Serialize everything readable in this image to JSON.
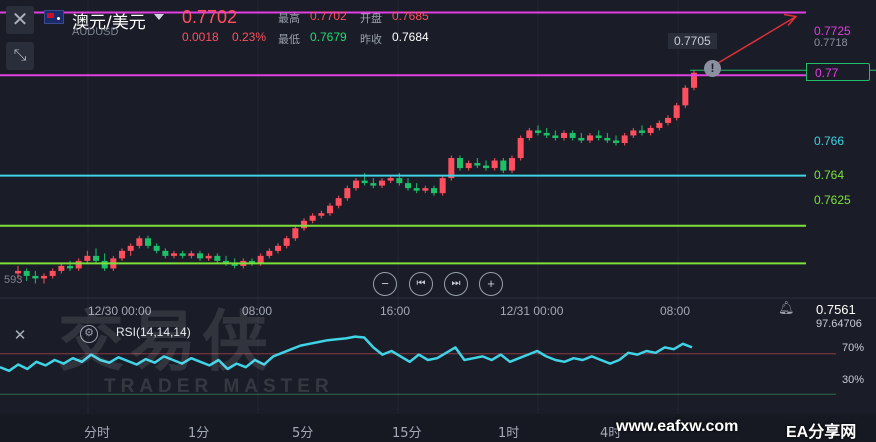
{
  "header": {
    "symbol_name": "澳元/美元",
    "symbol_code": "AUDUSD",
    "last_price": "0.7702",
    "change": "0.0018",
    "change_pct": "0.23%",
    "stats": {
      "high_label": "最高",
      "high_value": "0.7702",
      "open_label": "开盘",
      "open_value": "0.7685",
      "low_label": "最低",
      "low_value": "0.7679",
      "prev_close_label": "昨收",
      "prev_close_value": "0.7684"
    }
  },
  "price_axis": {
    "levels": [
      {
        "value": "0.7725",
        "color": "#e040e0"
      },
      {
        "value": "0.7718",
        "color": "#8a90a0"
      },
      {
        "value": "0.77",
        "color": "#e040e0"
      },
      {
        "value": "0.766",
        "color": "#3fd3e6"
      },
      {
        "value": "0.764",
        "color": "#7ee03a"
      },
      {
        "value": "0.7625",
        "color": "#7ee03a"
      }
    ],
    "crosshair_value": "0.7705",
    "left_value": "593"
  },
  "time_axis": [
    "12/30 00:00",
    "08:00",
    "16:00",
    "12/31 00:00",
    "08:00"
  ],
  "nav_controls": {
    "zoom_out": "−",
    "prev": "⏮",
    "next": "⏭",
    "zoom_in": "+"
  },
  "rsi": {
    "label": "RSI(14,14,14)",
    "current_value": "0.7561",
    "top_value": "97.64706",
    "level_70": "70%",
    "level_30": "30%"
  },
  "timeframes": [
    "分时",
    "1分",
    "5分",
    "15分",
    "1时",
    "4时"
  ],
  "watermark": {
    "brand": "交易侠",
    "brand_en": "TRADER MASTER",
    "site_url": "www.eafxw.com",
    "site_name": "EA分享网"
  },
  "colors": {
    "up": "#ff4f5e",
    "down": "#1fbf6a",
    "magenta_line": "#e040e0",
    "cyan_line": "#3fd3e6",
    "green_line": "#7ee03a",
    "rsi_line": "#3fd3e6"
  },
  "chart_data": {
    "type": "candlestick",
    "ohlc": [
      [
        0.7621,
        0.7624,
        0.7619,
        0.7622
      ],
      [
        0.7622,
        0.7623,
        0.7618,
        0.762
      ],
      [
        0.762,
        0.7622,
        0.7617,
        0.7619
      ],
      [
        0.7619,
        0.7621,
        0.7617,
        0.762
      ],
      [
        0.762,
        0.7623,
        0.7619,
        0.7622
      ],
      [
        0.7622,
        0.7625,
        0.7621,
        0.7624
      ],
      [
        0.7624,
        0.7626,
        0.7622,
        0.7623
      ],
      [
        0.7623,
        0.7627,
        0.7622,
        0.7626
      ],
      [
        0.7626,
        0.763,
        0.7625,
        0.7628
      ],
      [
        0.7628,
        0.7631,
        0.7625,
        0.7626
      ],
      [
        0.7626,
        0.7629,
        0.7622,
        0.7623
      ],
      [
        0.7623,
        0.7628,
        0.7622,
        0.7627
      ],
      [
        0.7627,
        0.7631,
        0.7626,
        0.763
      ],
      [
        0.763,
        0.7633,
        0.7628,
        0.7632
      ],
      [
        0.7632,
        0.7636,
        0.7631,
        0.7635
      ],
      [
        0.7635,
        0.7636,
        0.7631,
        0.7632
      ],
      [
        0.7632,
        0.7633,
        0.7629,
        0.763
      ],
      [
        0.763,
        0.7631,
        0.7627,
        0.7628
      ],
      [
        0.7628,
        0.763,
        0.7627,
        0.7629
      ],
      [
        0.7629,
        0.763,
        0.7627,
        0.7628
      ],
      [
        0.7628,
        0.763,
        0.7627,
        0.7629
      ],
      [
        0.7629,
        0.763,
        0.7626,
        0.7627
      ],
      [
        0.7627,
        0.7629,
        0.7626,
        0.7628
      ],
      [
        0.7628,
        0.7629,
        0.7625,
        0.7626
      ],
      [
        0.7626,
        0.7628,
        0.7624,
        0.7625
      ],
      [
        0.7625,
        0.7627,
        0.7623,
        0.7624
      ],
      [
        0.7624,
        0.7627,
        0.7623,
        0.7626
      ],
      [
        0.7626,
        0.7627,
        0.7624,
        0.7625
      ],
      [
        0.7625,
        0.7629,
        0.7624,
        0.7628
      ],
      [
        0.7628,
        0.7631,
        0.7627,
        0.763
      ],
      [
        0.763,
        0.7633,
        0.7629,
        0.7632
      ],
      [
        0.7632,
        0.7636,
        0.7631,
        0.7635
      ],
      [
        0.7635,
        0.764,
        0.7634,
        0.7639
      ],
      [
        0.7639,
        0.7643,
        0.7638,
        0.7642
      ],
      [
        0.7642,
        0.7645,
        0.7641,
        0.7644
      ],
      [
        0.7644,
        0.7646,
        0.7643,
        0.7645
      ],
      [
        0.7645,
        0.7649,
        0.7644,
        0.7648
      ],
      [
        0.7648,
        0.7652,
        0.7647,
        0.7651
      ],
      [
        0.7651,
        0.7656,
        0.765,
        0.7655
      ],
      [
        0.7655,
        0.7659,
        0.7654,
        0.7658
      ],
      [
        0.7658,
        0.7661,
        0.7656,
        0.7657
      ],
      [
        0.7657,
        0.7659,
        0.7655,
        0.7656
      ],
      [
        0.7656,
        0.7659,
        0.7655,
        0.7658
      ],
      [
        0.7658,
        0.766,
        0.7657,
        0.7659
      ],
      [
        0.7659,
        0.7661,
        0.7656,
        0.7657
      ],
      [
        0.7657,
        0.7659,
        0.7654,
        0.7655
      ],
      [
        0.7655,
        0.7657,
        0.7653,
        0.7654
      ],
      [
        0.7654,
        0.7656,
        0.7653,
        0.7655
      ],
      [
        0.7655,
        0.7656,
        0.7652,
        0.7653
      ],
      [
        0.7653,
        0.766,
        0.7652,
        0.7659
      ],
      [
        0.7659,
        0.7668,
        0.7658,
        0.7667
      ],
      [
        0.7667,
        0.7668,
        0.7662,
        0.7663
      ],
      [
        0.7663,
        0.7666,
        0.7662,
        0.7665
      ],
      [
        0.7665,
        0.7667,
        0.7663,
        0.7664
      ],
      [
        0.7664,
        0.7666,
        0.7662,
        0.7663
      ],
      [
        0.7663,
        0.7667,
        0.7662,
        0.7666
      ],
      [
        0.7666,
        0.7667,
        0.7661,
        0.7662
      ],
      [
        0.7662,
        0.7668,
        0.7661,
        0.7667
      ],
      [
        0.7667,
        0.7676,
        0.7666,
        0.7675
      ],
      [
        0.7675,
        0.7679,
        0.7674,
        0.7678
      ],
      [
        0.7678,
        0.768,
        0.7676,
        0.7677
      ],
      [
        0.7677,
        0.7679,
        0.7675,
        0.7676
      ],
      [
        0.7676,
        0.7678,
        0.7674,
        0.7675
      ],
      [
        0.7675,
        0.7678,
        0.7674,
        0.7677
      ],
      [
        0.7677,
        0.7678,
        0.7674,
        0.7675
      ],
      [
        0.7675,
        0.7677,
        0.7673,
        0.7674
      ],
      [
        0.7674,
        0.7677,
        0.7673,
        0.7676
      ],
      [
        0.7676,
        0.7678,
        0.7674,
        0.7675
      ],
      [
        0.7675,
        0.7677,
        0.7673,
        0.7674
      ],
      [
        0.7674,
        0.7676,
        0.7672,
        0.7673
      ],
      [
        0.7673,
        0.7677,
        0.7672,
        0.7676
      ],
      [
        0.7676,
        0.7679,
        0.7675,
        0.7678
      ],
      [
        0.7678,
        0.768,
        0.7676,
        0.7677
      ],
      [
        0.7677,
        0.768,
        0.7676,
        0.7679
      ],
      [
        0.7679,
        0.7682,
        0.7678,
        0.7681
      ],
      [
        0.7681,
        0.7684,
        0.768,
        0.7683
      ],
      [
        0.7683,
        0.7689,
        0.7682,
        0.7688
      ],
      [
        0.7688,
        0.7696,
        0.7687,
        0.7695
      ],
      [
        0.7695,
        0.7702,
        0.7694,
        0.7701
      ]
    ],
    "rsi_values": [
      52,
      48,
      55,
      50,
      58,
      54,
      60,
      56,
      62,
      58,
      66,
      60,
      57,
      63,
      59,
      55,
      61,
      57,
      64,
      60,
      56,
      62,
      58,
      54,
      60,
      50,
      56,
      52,
      60,
      55,
      64,
      68,
      72,
      76,
      78,
      80,
      82,
      83,
      84,
      86,
      85,
      74,
      66,
      70,
      64,
      58,
      66,
      60,
      62,
      68,
      74,
      60,
      62,
      64,
      60,
      66,
      58,
      62,
      66,
      70,
      64,
      60,
      58,
      62,
      60,
      64,
      60,
      56,
      60,
      68,
      66,
      70,
      68,
      74,
      72,
      78,
      74
    ],
    "ylim": [
      0.7612,
      0.773
    ],
    "rsi_ylim": [
      0,
      100
    ]
  }
}
